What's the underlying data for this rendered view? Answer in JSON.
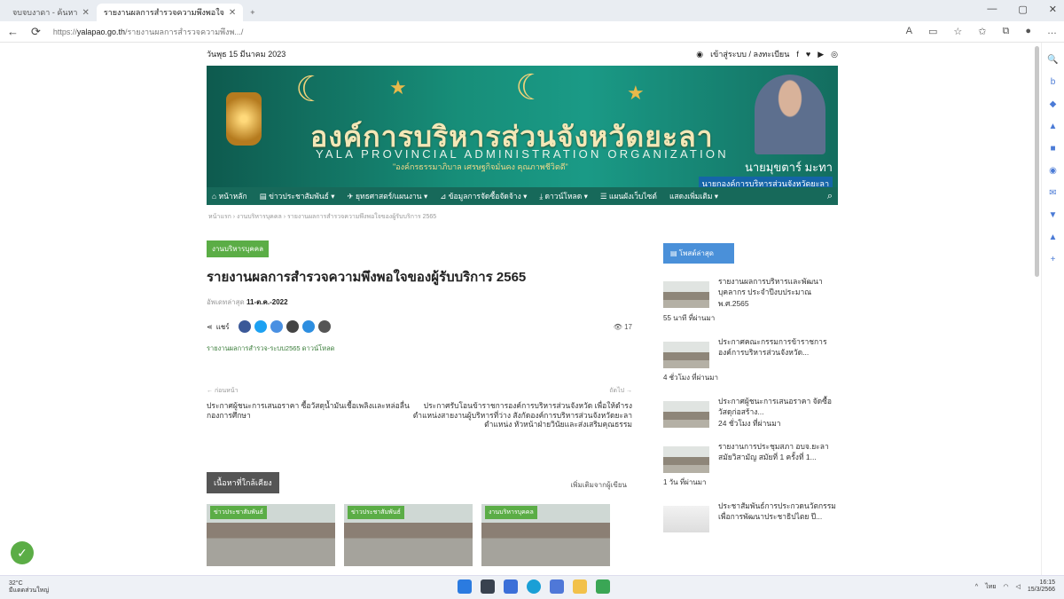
{
  "browser": {
    "tabs": [
      {
        "label": "จบจบงาดา - ค้นหา"
      },
      {
        "label": "รายงานผลการสำรวจความพึงพอใจ"
      }
    ],
    "new_tab": "+",
    "url_prefix": "https://",
    "url_host": "yalapao.go.th",
    "url_path": "/รายงานผลการสำรวจความพึงพ.../"
  },
  "site": {
    "date": "วันพุธ 15 มีนาคม 2023",
    "login": "เข้าสู่ระบบ / ลงทะเบียน",
    "title_th": "องค์การบริหารส่วนจังหวัดยะลา",
    "title_en": "YALA PROVINCIAL ADMINISTRATION ORGANIZATION",
    "slogan": "\"องค์กรธรรมาภิบาล เศรษฐกิจมั่นคง คุณภาพชีวิตดี\"",
    "gov_name": "นายมุขตาร์ มะทา",
    "gov_title": "นายกองค์การบริหารส่วนจังหวัดยะลา",
    "menu": [
      "หน้าหลัก",
      "ข่าวประชาสัมพันธ์",
      "ยุทธศาสตร์/แผนงาน",
      "ข้อมูลการจัดซื้อจัดจ้าง",
      "ดาวน์โหลด",
      "แผนผังเว็บไซต์",
      "แสดงเพิ่มเติม"
    ],
    "breadcrumb": "หน้าแรก › งานบริหารบุคคล › รายงานผลการสำรวจความพึงพอใจของผู้รับบริการ 2565"
  },
  "article": {
    "category": "งานบริหารบุคคล",
    "title": "รายงานผลการสำรวจความพึงพอใจของผู้รับบริการ 2565",
    "date_label": "อัพเดทล่าสุด",
    "date": "11-ต.ค.-2022",
    "share_label": "แชร์",
    "views": "17",
    "tags": "รายงานผลการสำรวจ-ระบบ2565 ดาวน์โหลด",
    "prev_label": "← ก่อนหน้า",
    "next_label": "ถัดไป →",
    "prev_text": "ประกาศผู้ชนะการเสนอราคา ซื้อวัสดุน้ำมันเชื้อเพลิงและหล่อลื่น กองการศึกษา",
    "next_text": "ประกาศรับโอนข้าราชการองค์การบริหารส่วนจังหวัด เพื่อให้ดำรงตำแหน่งสายงานผู้บริหารที่ว่าง สังกัดองค์การบริหารส่วนจังหวัดยะลา ตำแหน่ง หัวหน้าฝ่ายวินัยและส่งเสริมคุณธรรม",
    "related_label": "เนื้อหาที่ใกล้เคียง",
    "related_more": "เพิ่มเติมจากผู้เขียน",
    "related_cards": [
      "ข่าวประชาสัมพันธ์",
      "ข่าวประชาสัมพันธ์",
      "งานบริหารบุคคล"
    ]
  },
  "sidebar": {
    "header": "โพสต์ล่าสุด",
    "items": [
      {
        "title": "รายงานผลการบริหารและพัฒนาบุคลากร ประจำปีงบประมาณ พ.ศ.2565",
        "time": "55 นาที ที่ผ่านมา"
      },
      {
        "title": "ประกาศคณะกรรมการข้าราชการองค์การบริหารส่วนจังหวัด...",
        "time": "4 ชั่วโมง ที่ผ่านมา"
      },
      {
        "title": "ประกาศผู้ชนะการเสนอราคา จัดซื้อวัสดุก่อสร้าง...",
        "time": "24 ชั่วโมง ที่ผ่านมา"
      },
      {
        "title": "รายงานการประชุมสภา อบจ.ยะลา สมัยวิสามัญ สมัยที่ 1 ครั้งที่ 1...",
        "time": "1 วัน ที่ผ่านมา"
      },
      {
        "title": "ประชาสัมพันธ์การประกวดนวัตกรรมเพื่อการพัฒนาประชาธิปไตย ปี...",
        "time": ""
      }
    ]
  },
  "taskbar": {
    "weather_temp": "32°C",
    "weather_desc": "มีแดดส่วนใหญ่",
    "lang": "ไทย",
    "time": "16:15",
    "date": "15/3/2566"
  }
}
